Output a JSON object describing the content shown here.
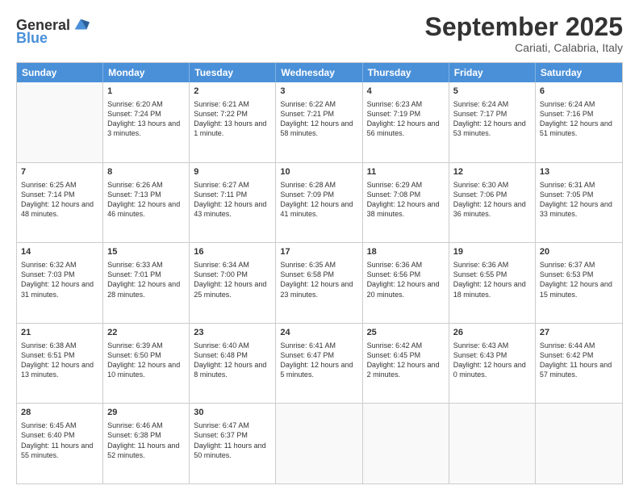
{
  "header": {
    "logo_general": "General",
    "logo_blue": "Blue",
    "month_title": "September 2025",
    "location": "Cariati, Calabria, Italy"
  },
  "weekdays": [
    "Sunday",
    "Monday",
    "Tuesday",
    "Wednesday",
    "Thursday",
    "Friday",
    "Saturday"
  ],
  "rows": [
    [
      {
        "day": "",
        "sunrise": "",
        "sunset": "",
        "daylight": "",
        "empty": true
      },
      {
        "day": "1",
        "sunrise": "Sunrise: 6:20 AM",
        "sunset": "Sunset: 7:24 PM",
        "daylight": "Daylight: 13 hours and 3 minutes."
      },
      {
        "day": "2",
        "sunrise": "Sunrise: 6:21 AM",
        "sunset": "Sunset: 7:22 PM",
        "daylight": "Daylight: 13 hours and 1 minute."
      },
      {
        "day": "3",
        "sunrise": "Sunrise: 6:22 AM",
        "sunset": "Sunset: 7:21 PM",
        "daylight": "Daylight: 12 hours and 58 minutes."
      },
      {
        "day": "4",
        "sunrise": "Sunrise: 6:23 AM",
        "sunset": "Sunset: 7:19 PM",
        "daylight": "Daylight: 12 hours and 56 minutes."
      },
      {
        "day": "5",
        "sunrise": "Sunrise: 6:24 AM",
        "sunset": "Sunset: 7:17 PM",
        "daylight": "Daylight: 12 hours and 53 minutes."
      },
      {
        "day": "6",
        "sunrise": "Sunrise: 6:24 AM",
        "sunset": "Sunset: 7:16 PM",
        "daylight": "Daylight: 12 hours and 51 minutes."
      }
    ],
    [
      {
        "day": "7",
        "sunrise": "Sunrise: 6:25 AM",
        "sunset": "Sunset: 7:14 PM",
        "daylight": "Daylight: 12 hours and 48 minutes."
      },
      {
        "day": "8",
        "sunrise": "Sunrise: 6:26 AM",
        "sunset": "Sunset: 7:13 PM",
        "daylight": "Daylight: 12 hours and 46 minutes."
      },
      {
        "day": "9",
        "sunrise": "Sunrise: 6:27 AM",
        "sunset": "Sunset: 7:11 PM",
        "daylight": "Daylight: 12 hours and 43 minutes."
      },
      {
        "day": "10",
        "sunrise": "Sunrise: 6:28 AM",
        "sunset": "Sunset: 7:09 PM",
        "daylight": "Daylight: 12 hours and 41 minutes."
      },
      {
        "day": "11",
        "sunrise": "Sunrise: 6:29 AM",
        "sunset": "Sunset: 7:08 PM",
        "daylight": "Daylight: 12 hours and 38 minutes."
      },
      {
        "day": "12",
        "sunrise": "Sunrise: 6:30 AM",
        "sunset": "Sunset: 7:06 PM",
        "daylight": "Daylight: 12 hours and 36 minutes."
      },
      {
        "day": "13",
        "sunrise": "Sunrise: 6:31 AM",
        "sunset": "Sunset: 7:05 PM",
        "daylight": "Daylight: 12 hours and 33 minutes."
      }
    ],
    [
      {
        "day": "14",
        "sunrise": "Sunrise: 6:32 AM",
        "sunset": "Sunset: 7:03 PM",
        "daylight": "Daylight: 12 hours and 31 minutes."
      },
      {
        "day": "15",
        "sunrise": "Sunrise: 6:33 AM",
        "sunset": "Sunset: 7:01 PM",
        "daylight": "Daylight: 12 hours and 28 minutes."
      },
      {
        "day": "16",
        "sunrise": "Sunrise: 6:34 AM",
        "sunset": "Sunset: 7:00 PM",
        "daylight": "Daylight: 12 hours and 25 minutes."
      },
      {
        "day": "17",
        "sunrise": "Sunrise: 6:35 AM",
        "sunset": "Sunset: 6:58 PM",
        "daylight": "Daylight: 12 hours and 23 minutes."
      },
      {
        "day": "18",
        "sunrise": "Sunrise: 6:36 AM",
        "sunset": "Sunset: 6:56 PM",
        "daylight": "Daylight: 12 hours and 20 minutes."
      },
      {
        "day": "19",
        "sunrise": "Sunrise: 6:36 AM",
        "sunset": "Sunset: 6:55 PM",
        "daylight": "Daylight: 12 hours and 18 minutes."
      },
      {
        "day": "20",
        "sunrise": "Sunrise: 6:37 AM",
        "sunset": "Sunset: 6:53 PM",
        "daylight": "Daylight: 12 hours and 15 minutes."
      }
    ],
    [
      {
        "day": "21",
        "sunrise": "Sunrise: 6:38 AM",
        "sunset": "Sunset: 6:51 PM",
        "daylight": "Daylight: 12 hours and 13 minutes."
      },
      {
        "day": "22",
        "sunrise": "Sunrise: 6:39 AM",
        "sunset": "Sunset: 6:50 PM",
        "daylight": "Daylight: 12 hours and 10 minutes."
      },
      {
        "day": "23",
        "sunrise": "Sunrise: 6:40 AM",
        "sunset": "Sunset: 6:48 PM",
        "daylight": "Daylight: 12 hours and 8 minutes."
      },
      {
        "day": "24",
        "sunrise": "Sunrise: 6:41 AM",
        "sunset": "Sunset: 6:47 PM",
        "daylight": "Daylight: 12 hours and 5 minutes."
      },
      {
        "day": "25",
        "sunrise": "Sunrise: 6:42 AM",
        "sunset": "Sunset: 6:45 PM",
        "daylight": "Daylight: 12 hours and 2 minutes."
      },
      {
        "day": "26",
        "sunrise": "Sunrise: 6:43 AM",
        "sunset": "Sunset: 6:43 PM",
        "daylight": "Daylight: 12 hours and 0 minutes."
      },
      {
        "day": "27",
        "sunrise": "Sunrise: 6:44 AM",
        "sunset": "Sunset: 6:42 PM",
        "daylight": "Daylight: 11 hours and 57 minutes."
      }
    ],
    [
      {
        "day": "28",
        "sunrise": "Sunrise: 6:45 AM",
        "sunset": "Sunset: 6:40 PM",
        "daylight": "Daylight: 11 hours and 55 minutes."
      },
      {
        "day": "29",
        "sunrise": "Sunrise: 6:46 AM",
        "sunset": "Sunset: 6:38 PM",
        "daylight": "Daylight: 11 hours and 52 minutes."
      },
      {
        "day": "30",
        "sunrise": "Sunrise: 6:47 AM",
        "sunset": "Sunset: 6:37 PM",
        "daylight": "Daylight: 11 hours and 50 minutes."
      },
      {
        "day": "",
        "sunrise": "",
        "sunset": "",
        "daylight": "",
        "empty": true
      },
      {
        "day": "",
        "sunrise": "",
        "sunset": "",
        "daylight": "",
        "empty": true
      },
      {
        "day": "",
        "sunrise": "",
        "sunset": "",
        "daylight": "",
        "empty": true
      },
      {
        "day": "",
        "sunrise": "",
        "sunset": "",
        "daylight": "",
        "empty": true
      }
    ]
  ]
}
